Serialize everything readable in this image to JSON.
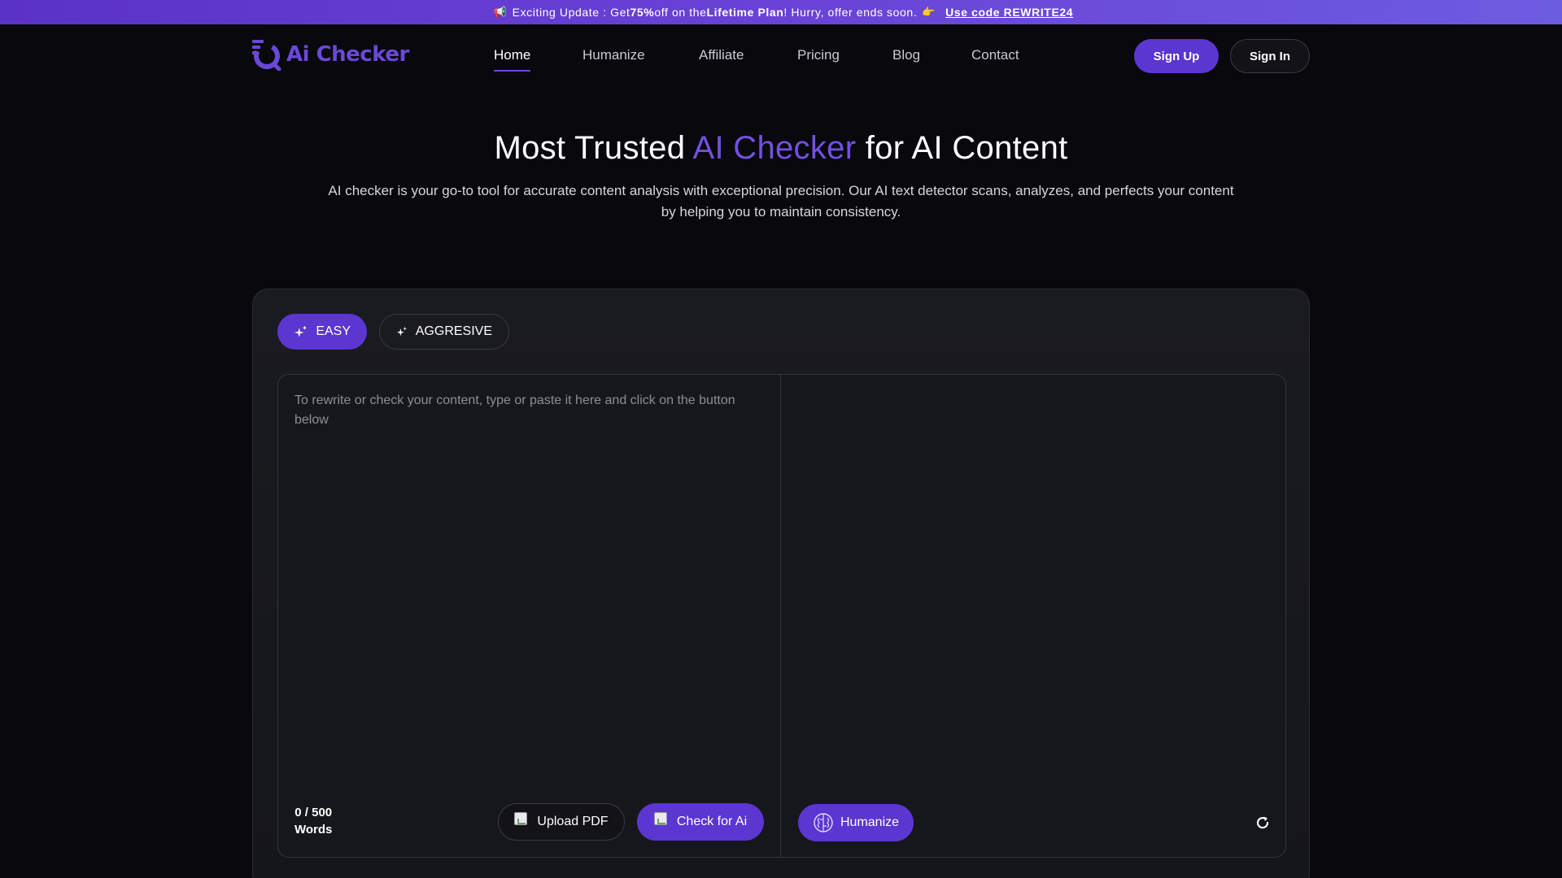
{
  "banner": {
    "megaphone": "📢",
    "pre": "Exciting Update : Get ",
    "discount": "75%",
    "mid": " off on the ",
    "plan": "Lifetime Plan",
    "post": " ! Hurry, offer ends soon.",
    "hand": "👉",
    "link": "Use code REWRITE24"
  },
  "header": {
    "logo_text": "Ai Checker",
    "nav": [
      {
        "label": "Home",
        "active": true
      },
      {
        "label": "Humanize"
      },
      {
        "label": "Affiliate"
      },
      {
        "label": "Pricing"
      },
      {
        "label": "Blog"
      },
      {
        "label": "Contact"
      }
    ],
    "signup": "Sign Up",
    "signin": "Sign In"
  },
  "hero": {
    "title_pre": "Most Trusted ",
    "title_accent": "AI Checker",
    "title_post": " for AI Content",
    "description": "AI checker is your go-to tool for accurate content analysis with exceptional precision. Our AI text detector scans, analyzes, and perfects your content by helping you to maintain consistency."
  },
  "tool": {
    "modes": {
      "easy": "EASY",
      "aggressive": "AGGRESIVE"
    },
    "input_placeholder": "To rewrite or check your content, type or paste it here and click on the button below",
    "word_count": "0 / 500",
    "word_unit": "Words",
    "upload_label": "Upload PDF",
    "check_label": "Check for Ai",
    "humanize_label": "Humanize"
  },
  "colors": {
    "accent": "#5b36d0",
    "accent_text": "#7350e0",
    "background": "#09080d"
  }
}
